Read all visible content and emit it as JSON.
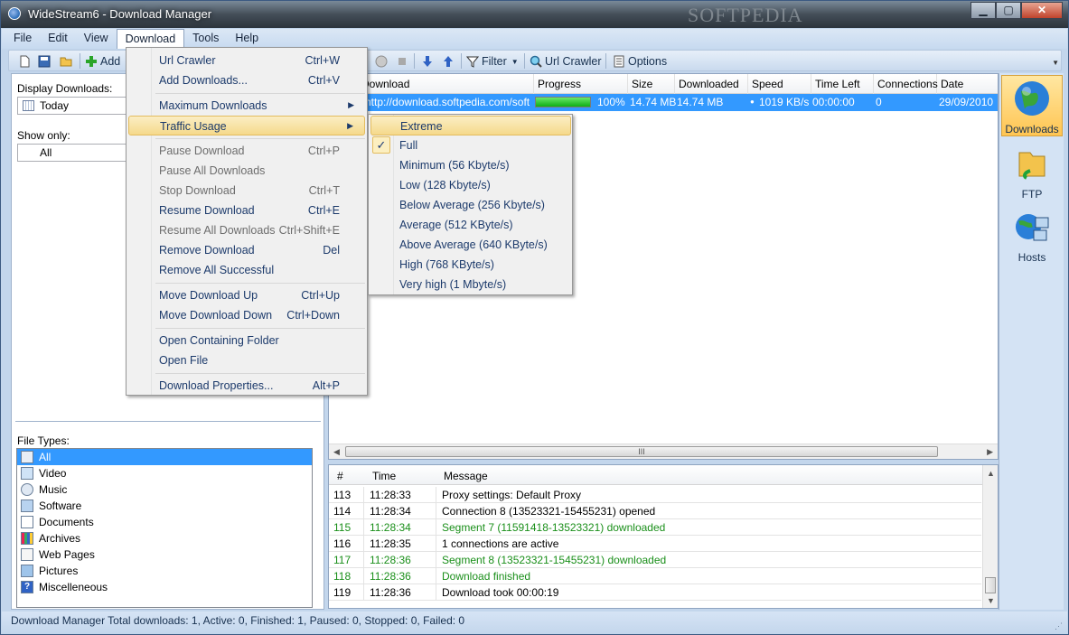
{
  "window": {
    "title": "WideStream6 - Download Manager",
    "watermark": "SOFTPEDIA",
    "controls": {
      "minimize": "▁",
      "maximize": "▢",
      "close": "✕"
    }
  },
  "menubar": [
    "File",
    "Edit",
    "View",
    "Download",
    "Tools",
    "Help"
  ],
  "toolbar": {
    "add_label": "Add",
    "filter_label": "Filter",
    "url_crawler_label": "Url Crawler",
    "options_label": "Options",
    "icons": [
      "new-icon",
      "save-icon",
      "open-folder-icon",
      "add-icon",
      "circle-icon",
      "stop-icon",
      "move-down-icon",
      "move-up-icon",
      "filter-icon",
      "url-crawler-icon",
      "options-icon"
    ]
  },
  "left_panel": {
    "display_label": "Display Downloads:",
    "display_value": "Today",
    "show_only_label": "Show only:",
    "show_only_value": "All",
    "file_types_label": "File Types:",
    "file_types": [
      "All",
      "Video",
      "Music",
      "Software",
      "Documents",
      "Archives",
      "Web Pages",
      "Pictures",
      "Miscelleneous"
    ]
  },
  "grid": {
    "columns": [
      "Download",
      "Progress",
      "Size",
      "Downloaded",
      "Speed",
      "Time Left",
      "Connections",
      "Date"
    ],
    "rows": [
      {
        "download": "http://download.softpedia.com/soft",
        "progress_percent": 100,
        "progress_text": "100%",
        "size": "14.74 MB",
        "downloaded": "14.74 MB",
        "speed": "1019 KB/s",
        "time_left": "00:00:00",
        "connections": "0",
        "date": "29/09/2010"
      }
    ],
    "hscroll_grip": "III"
  },
  "log": {
    "columns": [
      "#",
      "Time",
      "Message"
    ],
    "rows": [
      {
        "n": "113",
        "time": "11:28:33",
        "msg": "Proxy settings: Default Proxy",
        "green": false
      },
      {
        "n": "114",
        "time": "11:28:34",
        "msg": "Connection 8 (13523321-15455231) opened",
        "green": false
      },
      {
        "n": "115",
        "time": "11:28:34",
        "msg": "Segment 7 (11591418-13523321) downloaded",
        "green": true
      },
      {
        "n": "116",
        "time": "11:28:35",
        "msg": "1 connections are active",
        "green": false
      },
      {
        "n": "117",
        "time": "11:28:36",
        "msg": "Segment 8 (13523321-15455231) downloaded",
        "green": true
      },
      {
        "n": "118",
        "time": "11:28:36",
        "msg": "Download finished",
        "green": true
      },
      {
        "n": "119",
        "time": "11:28:36",
        "msg": "Download took 00:00:19",
        "green": false
      }
    ]
  },
  "right_panel": [
    "Downloads",
    "FTP",
    "Hosts"
  ],
  "status": "Download Manager  Total downloads: 1, Active: 0, Finished: 1, Paused: 0, Stopped: 0, Failed: 0",
  "download_menu": [
    {
      "label": "Url Crawler",
      "shortcut": "Ctrl+W",
      "disabled": false
    },
    {
      "label": "Add Downloads...",
      "shortcut": "Ctrl+V",
      "disabled": false
    },
    {
      "label": "Maximum Downloads",
      "shortcut": "",
      "disabled": false,
      "submenu": true
    },
    {
      "label": "Traffic Usage",
      "shortcut": "",
      "disabled": false,
      "submenu": true,
      "hover": true
    },
    {
      "label": "Pause Download",
      "shortcut": "Ctrl+P",
      "disabled": true
    },
    {
      "label": "Pause All Downloads",
      "shortcut": "",
      "disabled": true
    },
    {
      "label": "Stop Download",
      "shortcut": "Ctrl+T",
      "disabled": true
    },
    {
      "label": "Resume Download",
      "shortcut": "Ctrl+E",
      "disabled": false
    },
    {
      "label": "Resume All Downloads",
      "shortcut": "Ctrl+Shift+E",
      "disabled": true
    },
    {
      "label": "Remove Download",
      "shortcut": "Del",
      "disabled": false
    },
    {
      "label": "Remove All Successful",
      "shortcut": "",
      "disabled": false
    },
    {
      "label": "Move Download Up",
      "shortcut": "Ctrl+Up",
      "disabled": false
    },
    {
      "label": "Move Download Down",
      "shortcut": "Ctrl+Down",
      "disabled": false
    },
    {
      "label": "Open Containing Folder",
      "shortcut": "",
      "disabled": false
    },
    {
      "label": "Open  File",
      "shortcut": "",
      "disabled": false
    },
    {
      "label": "Download Properties...",
      "shortcut": "Alt+P",
      "disabled": false
    }
  ],
  "traffic_submenu": {
    "checked": "Full",
    "items": [
      "Extreme",
      "Full",
      "Minimum (56 Kbyte/s)",
      "Low (128 Kbyte/s)",
      "Below Average (256 Kbyte/s)",
      "Average (512 KByte/s)",
      "Above Average (640 KByte/s)",
      "High (768 KByte/s)",
      "Very high (1 Mbyte/s)"
    ]
  },
  "colors": {
    "selection": "#3399ff",
    "menu_text": "#1c3a6b",
    "log_green": "#1a8f1a",
    "menu_hover": "#f5d98b"
  }
}
